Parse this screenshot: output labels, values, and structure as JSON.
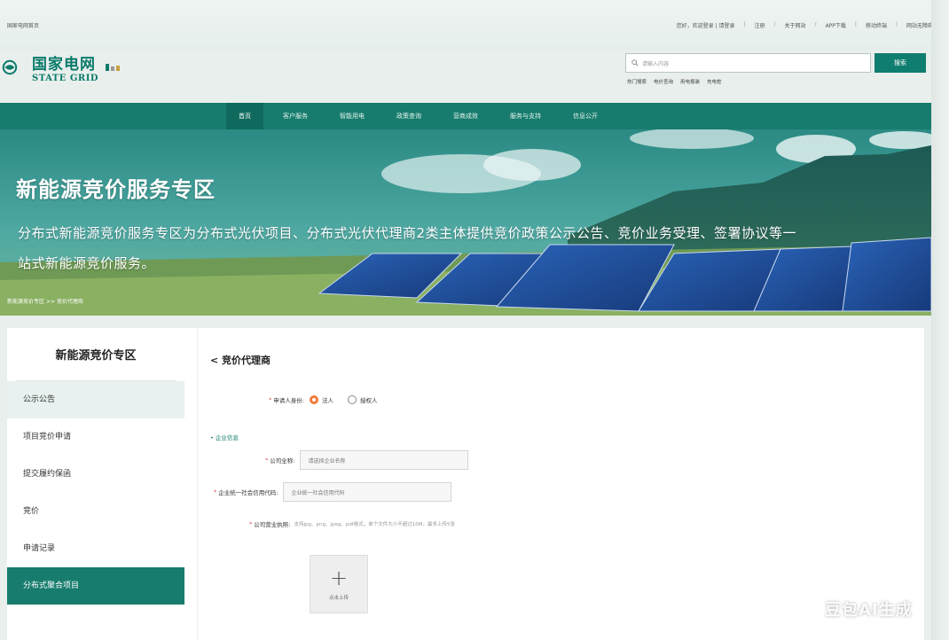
{
  "header": {
    "site_title": "国家电网首页",
    "links": [
      "您好，欢迎登录 | 请登录",
      "注册",
      "关于网站",
      "APP下载",
      "移动终端",
      "网站无障碍"
    ],
    "highlight_link": "请登录",
    "logo_cn": "国家电网",
    "logo_en": "STATE GRID",
    "search_placeholder": "请输入内容",
    "search_button": "搜索",
    "hot_words": [
      "热门搜索",
      "电价查询",
      "用电报装",
      "充电桩"
    ]
  },
  "nav": {
    "items": [
      "首页",
      "客户服务",
      "智能用电",
      "政策查询",
      "营商成效",
      "服务与支持",
      "信息公开"
    ],
    "active_index": 0
  },
  "banner": {
    "title": "新能源竞价服务专区",
    "description": "分布式新能源竞价服务专区为分布式光伏项目、分布式光伏代理商2类主体提供竞价政策公示公告、竞价业务受理、签署协议等一站式新能源竞价服务。",
    "breadcrumb": "新能源竞价专区 >> 竞价代理商"
  },
  "sidebar": {
    "title": "新能源竞价专区",
    "items": [
      "公示公告",
      "项目竞价申请",
      "提交履约保函",
      "竞价",
      "申请记录",
      "分布式聚合项目"
    ],
    "hover_index": 0,
    "active_index": 5
  },
  "form": {
    "back_title": "< 竞价代理商",
    "applicant_label": "申请人身份:",
    "applicant_options": [
      "法人",
      "授权人"
    ],
    "applicant_selected": 0,
    "section_title": "• 企业信息",
    "company_name_label": "公司全称:",
    "company_name_placeholder": "请选择企业名称",
    "credit_code_label": "企业统一社会信用代码:",
    "credit_code_placeholder": "企业统一社会信用代码",
    "license_label": "公司营业执照:",
    "license_hint": "支持jpg、png、jpeg、pdf格式，单个文件大小不超过10M，最多上传5张",
    "upload_plus": "+",
    "upload_label": "点击上传"
  },
  "watermark": "豆包AI生成",
  "colors": {
    "brand": "#177c6d",
    "brand_dark": "#0f6a5d",
    "radio_on": "#f07c3a",
    "required": "#d9534f"
  }
}
